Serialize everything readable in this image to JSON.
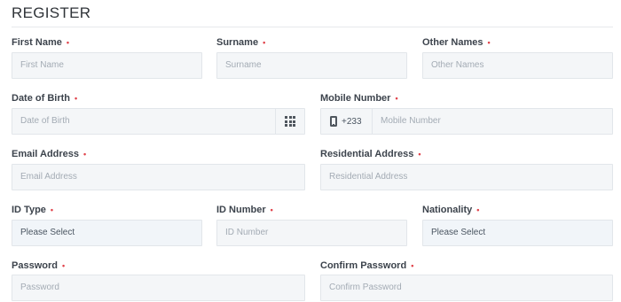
{
  "form": {
    "title": "REGISTER",
    "required_mark": "•",
    "fields": {
      "first_name": {
        "label": "First Name",
        "placeholder": "First Name"
      },
      "surname": {
        "label": "Surname",
        "placeholder": "Surname"
      },
      "other_names": {
        "label": "Other Names",
        "placeholder": "Other Names"
      },
      "date_of_birth": {
        "label": "Date of Birth",
        "placeholder": "Date of Birth",
        "icon": "calendar-grid-icon"
      },
      "mobile_number": {
        "label": "Mobile Number",
        "country_code": "+233",
        "placeholder": "Mobile Number",
        "icon": "mobile-phone-icon"
      },
      "email": {
        "label": "Email Address",
        "placeholder": "Email Address"
      },
      "residential_address": {
        "label": "Residential Address",
        "placeholder": "Residential Address"
      },
      "id_type": {
        "label": "ID Type",
        "value": "Please Select"
      },
      "id_number": {
        "label": "ID Number",
        "placeholder": "ID Number"
      },
      "nationality": {
        "label": "Nationality",
        "value": "Please Select"
      },
      "password": {
        "label": "Password",
        "placeholder": "Password"
      },
      "confirm_password": {
        "label": "Confirm Password",
        "placeholder": "Confirm Password"
      }
    }
  },
  "colors": {
    "required": "#e0424a",
    "field_background": "#f4f6f8",
    "field_border": "#e2e6ea"
  }
}
